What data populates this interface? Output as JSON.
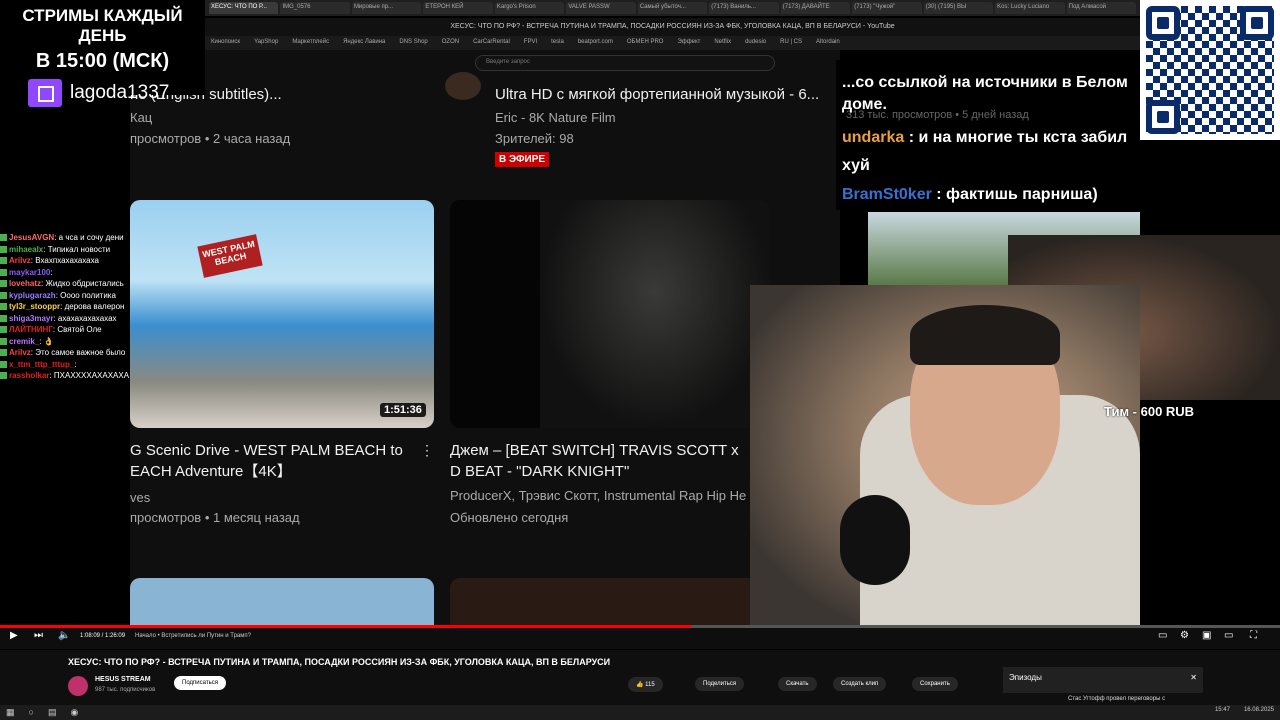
{
  "promo": {
    "line1": "СТРИМЫ КАЖДЫЙ ДЕНЬ",
    "line2": "В 15:00 (МСК)",
    "twitch": "lagoda1337"
  },
  "browser": {
    "tabs": [
      "ХЕСУС: ЧТО ПО Р...",
      "IMG_0576",
      "Мировые пр...",
      "ЕТЕРОН КЕЙ",
      "Kargo's Prison",
      "VALVE PASSW",
      "Самый убыточ...",
      "(7173) Ваниль...",
      "(7173) ДАВАЙТЕ",
      "(7173) \"Чужой\"",
      "(30) (7195) ВЫ",
      "Kos: Lucky Luciano",
      "Под Алмасой"
    ],
    "window_title": "ХЕСУС: ЧТО ПО РФ? - ВСТРЕЧА ПУТИНА И ТРАМПА, ПОСАДКИ РОССИЯН ИЗ-ЗА ФБК, УГОЛОВКА КАЦА, ВП В БЕЛАРУСИ - YouTube",
    "bookmarks": [
      "Кинопоиск",
      "YapShop",
      "Маркетплейс",
      "Яндекс Лавина",
      "DNS Shop",
      "OZON",
      "CarCarRental",
      "FPVI",
      "tesla",
      "beatport.com",
      "ОБМЕН PRO",
      "Эффект",
      "Netflix",
      "dudesio",
      "RU | CS",
      "Altordain"
    ],
    "search_placeholder": "Введите запрос"
  },
  "videos": [
    {
      "title": "не (English subtitles)...",
      "channel": "Кац",
      "meta": "просмотров • 2 часа назад"
    },
    {
      "title": "Ultra HD с мягкой фортепианной музыкой - 6...",
      "channel": "Eric - 8K Nature Film",
      "meta": "Зрителей: 98",
      "badge": "В ЭФИРЕ"
    },
    {
      "title": "G Scenic Drive - WEST PALM BEACH to EACH Adventure【4K】",
      "channel": "ves",
      "meta": "просмотров • 1 месяц назад",
      "duration": "1:51:36",
      "sign": "WEST PALM BEACH"
    },
    {
      "title": "Джем – [BEAT SWITCH] TRAVIS SCOTT x D BEAT - \"DARK KNIGHT\"",
      "channel": "ProducerX, Трэвис Скотт, Instrumental Rap Hip He",
      "meta": "Обновлено сегодня"
    }
  ],
  "chat": [
    {
      "user": "JesusAVGN",
      "text": "а чса и сочу дени",
      "color": "#ff6b6b"
    },
    {
      "user": "mihaealx",
      "text": "Типикал новости",
      "color": "#4caf50"
    },
    {
      "user": "Arilvz",
      "text": "Вхахпхахахахаха",
      "color": "#ff4040"
    },
    {
      "user": "maykar100",
      "text": "",
      "color": "#8a5cf5"
    },
    {
      "user": "lovehatz",
      "text": "Жидко обдристались",
      "color": "#ff6060"
    },
    {
      "user": "kyplugarazh",
      "text": "Оооо политика",
      "color": "#9b7bff"
    },
    {
      "user": "tyl3r_stooppr",
      "text": "дерова валерон",
      "color": "#ffd24a"
    },
    {
      "user": "shiga3mayr",
      "text": "ахахахахахахах",
      "color": "#b07aff"
    },
    {
      "user": "ЛАЙТНИНГ",
      "text": "Святой Оле",
      "color": "#e02020"
    },
    {
      "user": "cremik_",
      "text": "👌",
      "color": "#c070ff"
    },
    {
      "user": "Arilvz",
      "text": "Это самое важное было",
      "color": "#ff4040"
    },
    {
      "user": "x_ttm_tttp_tttup_",
      "text": "",
      "color": "#e02020"
    },
    {
      "user": "rassholkar",
      "text": "ПХАХХХХАХАХАХА",
      "color": "#e02020"
    }
  ],
  "overlay_chat": [
    {
      "user": "",
      "text": "...со ссылкой на источники в Белом доме.",
      "color": "#ffffff"
    },
    {
      "user": "undarka",
      "text": " : и на многие ты кста забил хуй",
      "color": "#e8a040"
    },
    {
      "user": "BramSt0ker",
      "text": " : фактишь парниша)",
      "color": "#3a70d0"
    }
  ],
  "overlay_bg_meta": "313 тыс. просмотров • 5 дней назад",
  "donation": "Тим - 600 RUB",
  "player": {
    "time": "1:08:09 / 1:26:09",
    "chapter": "Начало • Встретились ли Путин и Трамп?",
    "progress_percent": 54
  },
  "watch": {
    "title": "ХЕСУС: ЧТО ПО РФ? - ВСТРЕЧА ПУТИНА И ТРАМПА, ПОСАДКИ РОССИЯН ИЗ-ЗА ФБК, УГОЛОВКА КАЦА, ВП В БЕЛАРУСИ",
    "channel": "HESUS STREAM",
    "subs": "987 тыс. подписчиков",
    "subscribe": "Подписаться",
    "likes": "115",
    "share": "Поделиться",
    "download": "Скачать",
    "clip": "Создать клип",
    "save": "Сохранить",
    "episodes": "Эпизоды",
    "episode_item": "Стас Угтофф провел переговоры с"
  },
  "taskbar": {
    "time": "15:47",
    "date": "16.08.2025"
  }
}
